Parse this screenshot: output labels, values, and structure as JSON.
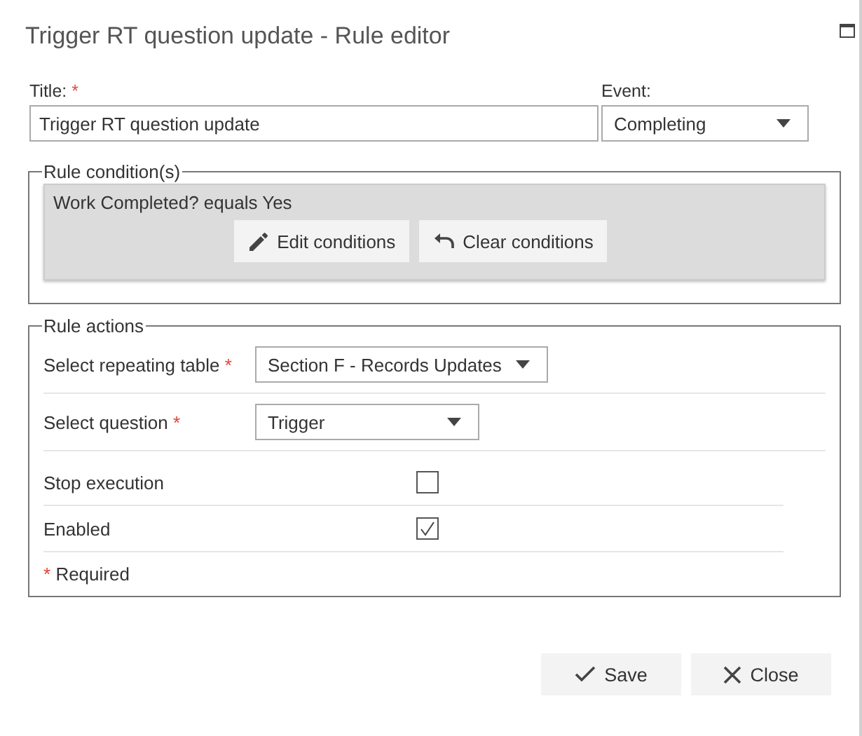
{
  "window": {
    "title": "Trigger RT question update - Rule editor"
  },
  "title_field": {
    "label": "Title:",
    "required_mark": "*",
    "value": "Trigger RT question update"
  },
  "event_field": {
    "label": "Event:",
    "value": "Completing"
  },
  "rule_conditions": {
    "legend": "Rule condition(s)",
    "summary": "Work Completed? equals Yes",
    "buttons": [
      {
        "kind": "edit",
        "label": "Edit conditions"
      },
      {
        "kind": "clear",
        "label": "Clear conditions"
      }
    ]
  },
  "rule_actions": {
    "legend": "Rule actions",
    "selects": [
      {
        "label": "Select repeating table",
        "required_mark": "*",
        "value": "Section F - Records Updates"
      },
      {
        "label": "Select question",
        "required_mark": "*",
        "value": "Trigger"
      }
    ],
    "checks": [
      {
        "label": "Stop execution",
        "checked": false
      },
      {
        "label": "Enabled",
        "checked": true
      }
    ],
    "required_note": {
      "mark": "*",
      "text": "Required"
    }
  },
  "buttons": [
    {
      "kind": "save",
      "label": "Save"
    },
    {
      "kind": "close",
      "label": "Close"
    }
  ]
}
